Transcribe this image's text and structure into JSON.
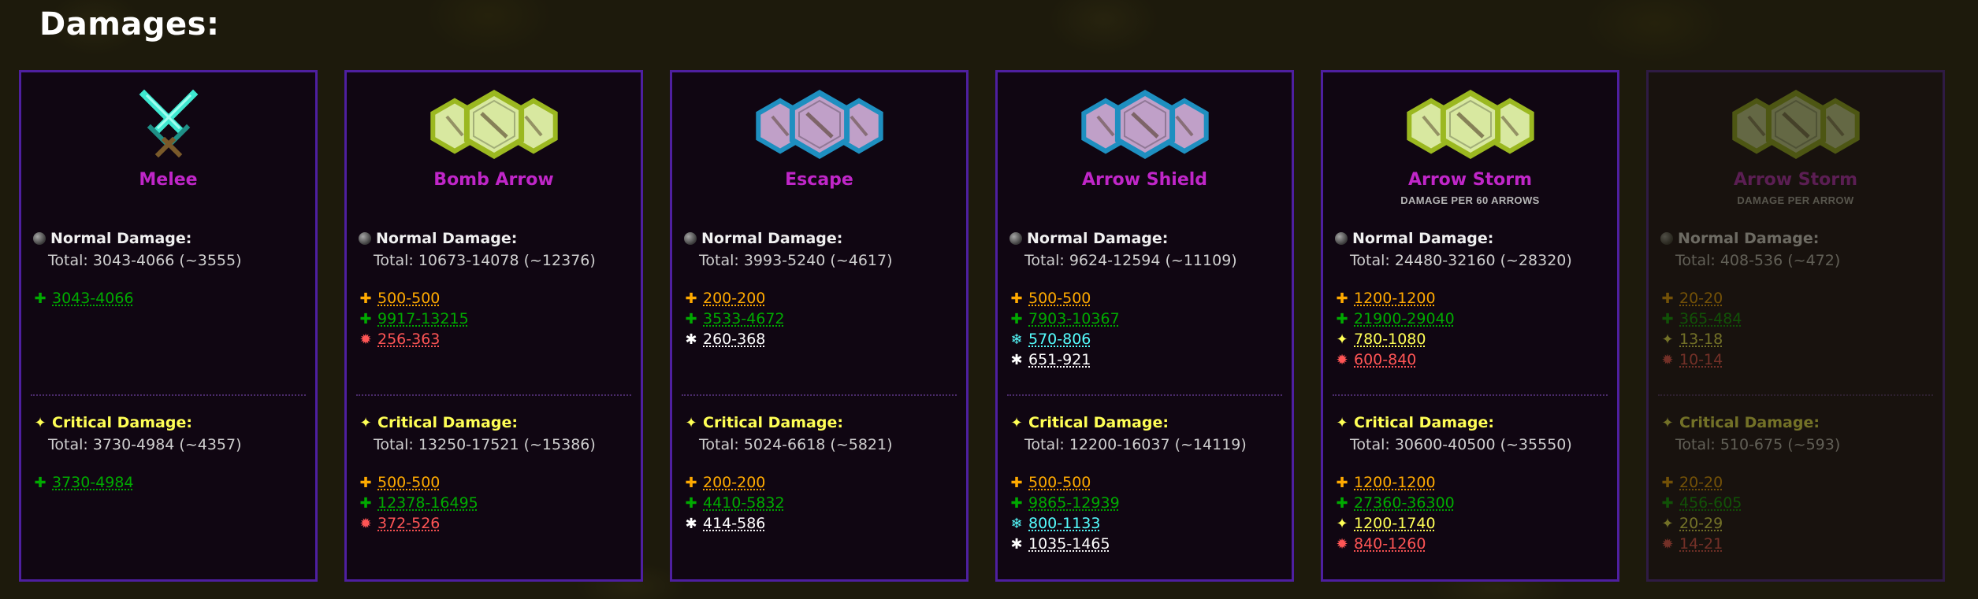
{
  "page_title": "Damages:",
  "colors": {
    "neutral": "#ffaa00",
    "earth": "#00aa00",
    "thunder": "#ffff55",
    "water": "#55ffff",
    "fire": "#ff5555",
    "air": "#ffffff",
    "title": "#c026c8",
    "card_border": "#4e1fa0"
  },
  "icons": {
    "normal": "gray-orb-icon",
    "critical": "sparkle-icon",
    "earth": "earth-cross-icon",
    "neutral": "neutral-cross-icon",
    "fire": "fire-burst-icon",
    "water": "snowflake-icon",
    "air": "air-swirl-icon",
    "thunder": "thunder-spark-icon"
  },
  "cards": [
    {
      "title": "Melee",
      "subtitle": "",
      "icon": "diamond-swords-icon",
      "normal": {
        "label": "Normal Damage:",
        "total": "Total: 3043-4066 (~3555)",
        "rows": [
          {
            "element": "earth",
            "value": "3043-4066"
          }
        ]
      },
      "critical": {
        "label": "Critical Damage:",
        "total": "Total: 3730-4984 (~4357)",
        "rows": [
          {
            "element": "earth",
            "value": "3730-4984"
          }
        ]
      }
    },
    {
      "title": "Bomb Arrow",
      "subtitle": "",
      "icon": "spell-hex-icon-earth",
      "normal": {
        "label": "Normal Damage:",
        "total": "Total: 10673-14078 (~12376)",
        "rows": [
          {
            "element": "neutral",
            "value": "500-500"
          },
          {
            "element": "earth",
            "value": "9917-13215"
          },
          {
            "element": "fire",
            "value": "256-363"
          }
        ]
      },
      "critical": {
        "label": "Critical Damage:",
        "total": "Total: 13250-17521 (~15386)",
        "rows": [
          {
            "element": "neutral",
            "value": "500-500"
          },
          {
            "element": "earth",
            "value": "12378-16495"
          },
          {
            "element": "fire",
            "value": "372-526"
          }
        ]
      }
    },
    {
      "title": "Escape",
      "subtitle": "",
      "icon": "spell-hex-icon-water",
      "normal": {
        "label": "Normal Damage:",
        "total": "Total: 3993-5240 (~4617)",
        "rows": [
          {
            "element": "neutral",
            "value": "200-200"
          },
          {
            "element": "earth",
            "value": "3533-4672"
          },
          {
            "element": "air",
            "value": "260-368"
          }
        ]
      },
      "critical": {
        "label": "Critical Damage:",
        "total": "Total: 5024-6618 (~5821)",
        "rows": [
          {
            "element": "neutral",
            "value": "200-200"
          },
          {
            "element": "earth",
            "value": "4410-5832"
          },
          {
            "element": "air",
            "value": "414-586"
          }
        ]
      }
    },
    {
      "title": "Arrow Shield",
      "subtitle": "",
      "icon": "spell-hex-icon-water",
      "normal": {
        "label": "Normal Damage:",
        "total": "Total: 9624-12594 (~11109)",
        "rows": [
          {
            "element": "neutral",
            "value": "500-500"
          },
          {
            "element": "earth",
            "value": "7903-10367"
          },
          {
            "element": "water",
            "value": "570-806"
          },
          {
            "element": "air",
            "value": "651-921"
          }
        ]
      },
      "critical": {
        "label": "Critical Damage:",
        "total": "Total: 12200-16037 (~14119)",
        "rows": [
          {
            "element": "neutral",
            "value": "500-500"
          },
          {
            "element": "earth",
            "value": "9865-12939"
          },
          {
            "element": "water",
            "value": "800-1133"
          },
          {
            "element": "air",
            "value": "1035-1465"
          }
        ]
      }
    },
    {
      "title": "Arrow Storm",
      "subtitle": "DAMAGE PER 60 ARROWS",
      "icon": "spell-hex-icon-earth",
      "normal": {
        "label": "Normal Damage:",
        "total": "Total: 24480-32160 (~28320)",
        "rows": [
          {
            "element": "neutral",
            "value": "1200-1200"
          },
          {
            "element": "earth",
            "value": "21900-29040"
          },
          {
            "element": "thunder",
            "value": "780-1080"
          },
          {
            "element": "fire",
            "value": "600-840"
          }
        ]
      },
      "critical": {
        "label": "Critical Damage:",
        "total": "Total: 30600-40500 (~35550)",
        "rows": [
          {
            "element": "neutral",
            "value": "1200-1200"
          },
          {
            "element": "earth",
            "value": "27360-36300"
          },
          {
            "element": "thunder",
            "value": "1200-1740"
          },
          {
            "element": "fire",
            "value": "840-1260"
          }
        ]
      }
    },
    {
      "title": "Arrow Storm",
      "subtitle": "DAMAGE PER ARROW",
      "icon": "spell-hex-icon-earth",
      "faded": true,
      "normal": {
        "label": "Normal Damage:",
        "total": "Total: 408-536 (~472)",
        "rows": [
          {
            "element": "neutral",
            "value": "20-20"
          },
          {
            "element": "earth",
            "value": "365-484"
          },
          {
            "element": "thunder",
            "value": "13-18"
          },
          {
            "element": "fire",
            "value": "10-14"
          }
        ]
      },
      "critical": {
        "label": "Critical Damage:",
        "total": "Total: 510-675 (~593)",
        "rows": [
          {
            "element": "neutral",
            "value": "20-20"
          },
          {
            "element": "earth",
            "value": "456-605"
          },
          {
            "element": "thunder",
            "value": "20-29"
          },
          {
            "element": "fire",
            "value": "14-21"
          }
        ]
      }
    }
  ]
}
